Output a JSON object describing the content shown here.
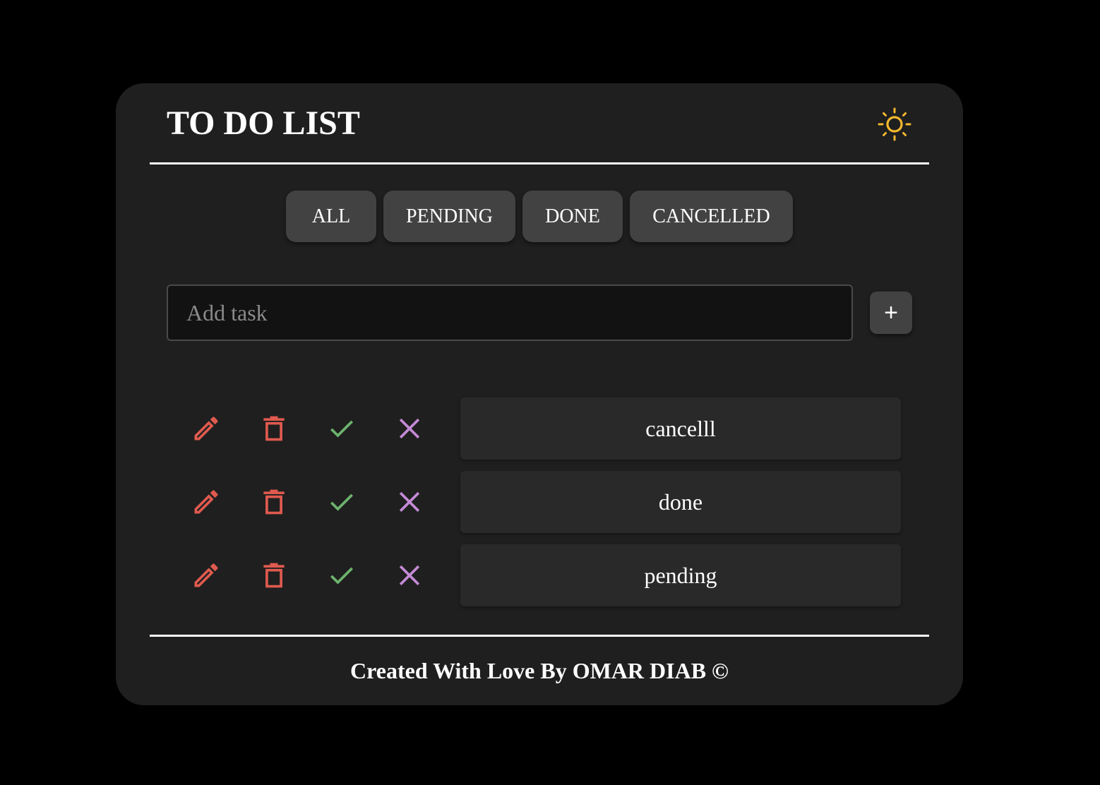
{
  "header": {
    "title": "TO DO LIST",
    "theme_icon": "sun-icon"
  },
  "filters": {
    "items": [
      {
        "label": "ALL"
      },
      {
        "label": "PENDING"
      },
      {
        "label": "DONE"
      },
      {
        "label": "CANCELLED"
      }
    ]
  },
  "add_task": {
    "placeholder": "Add task",
    "value": "",
    "add_label": "+"
  },
  "tasks": [
    {
      "text": "cancelll"
    },
    {
      "text": "done"
    },
    {
      "text": "pending"
    }
  ],
  "task_actions": {
    "icons": [
      "pencil-icon",
      "trash-icon",
      "check-icon",
      "close-icon"
    ]
  },
  "footer": {
    "text": "Created With Love By OMAR DIAB ©"
  },
  "colors": {
    "page_background": "#000000",
    "card_background": "#1f1f1f",
    "button_background": "#424242",
    "task_background": "#292929",
    "sun_accent": "#f5b82e",
    "edit_delete": "#e05a4f",
    "check": "#6db36d",
    "cancel": "#c48ad6"
  }
}
